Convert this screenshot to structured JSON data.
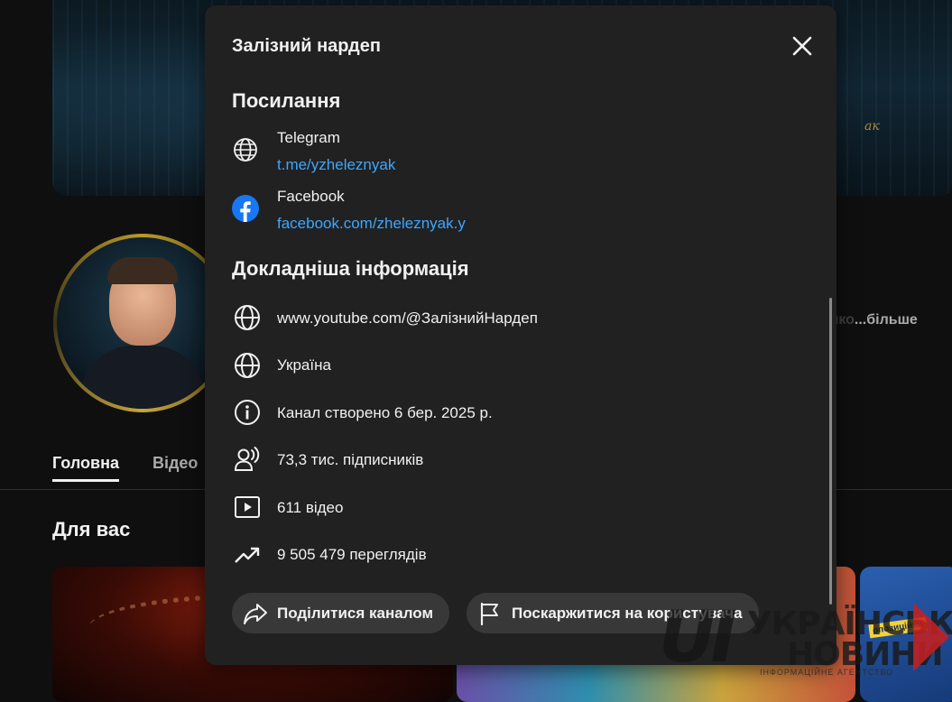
{
  "page": {
    "banner_signature": "ак",
    "more_link": "...більше",
    "more_link_prefix": "яко",
    "tabs": [
      {
        "label": "Головна"
      },
      {
        "label": "Відео"
      }
    ],
    "section_title": "Для вас",
    "thumb_label": "опозиційна"
  },
  "modal": {
    "title": "Залізний нардеп",
    "links_heading": "Посилання",
    "links": [
      {
        "name": "Telegram",
        "url": "t.me/yzheleznyak",
        "icon": "globe-icon"
      },
      {
        "name": "Facebook",
        "url": "facebook.com/zheleznyak.y",
        "icon": "facebook-icon"
      }
    ],
    "details_heading": "Докладніша інформація",
    "details": [
      {
        "icon": "globe-icon",
        "text": "www.youtube.com/@ЗалізнийНардеп"
      },
      {
        "icon": "globe-icon",
        "text": "Україна"
      },
      {
        "icon": "info-icon",
        "text": "Канал створено 6 бер. 2025 р."
      },
      {
        "icon": "subscribers-icon",
        "text": "73,3 тис. підписників"
      },
      {
        "icon": "video-icon",
        "text": "611 відео"
      },
      {
        "icon": "trending-icon",
        "text": "9 505 479 переглядів"
      }
    ],
    "share_button": "Поділитися каналом",
    "report_button": "Поскаржитися на користувача"
  },
  "watermark": {
    "logo_text": "UI",
    "line1": "УКРАЇНСЬКІ",
    "line2": "НОВИНИ",
    "line3": "ІНФОРМАЦІЙНЕ АГЕНТСТВО"
  },
  "colors": {
    "background": "#0f0f0f",
    "modal": "#212121",
    "link": "#3ea6ff",
    "pill": "#383838",
    "facebook": "#1877f2"
  }
}
